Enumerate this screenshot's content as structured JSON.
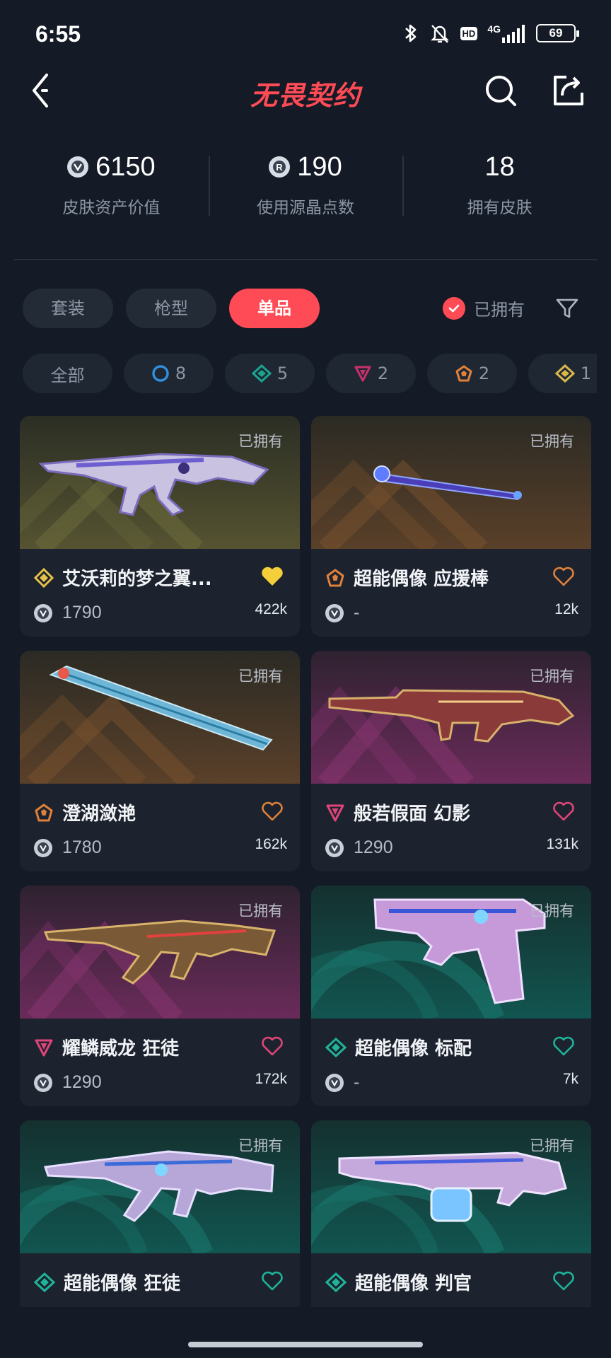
{
  "status_bar": {
    "time": "6:55",
    "network": "4G",
    "hd": "HD",
    "battery": "69"
  },
  "header": {
    "title": "无畏契约"
  },
  "stats": [
    {
      "value": "6150",
      "label": "皮肤资产价值",
      "icon": "vp-coin-icon"
    },
    {
      "value": "190",
      "label": "使用源晶点数",
      "icon": "radianite-coin-icon"
    },
    {
      "value": "18",
      "label": "拥有皮肤"
    }
  ],
  "tabs": [
    {
      "label": "套装",
      "active": false
    },
    {
      "label": "枪型",
      "active": false
    },
    {
      "label": "单品",
      "active": true
    }
  ],
  "owned_filter": {
    "label": "已拥有",
    "checked": true
  },
  "tier_chips": [
    {
      "label": "全部"
    },
    {
      "count": "8",
      "tier": "select",
      "color": "#2f8fe0"
    },
    {
      "count": "5",
      "tier": "deluxe",
      "color": "#1aa48f"
    },
    {
      "count": "2",
      "tier": "premium",
      "color": "#c8306a"
    },
    {
      "count": "2",
      "tier": "exclusive",
      "color": "#e0813a"
    },
    {
      "count": "1",
      "tier": "ultra",
      "color": "#d8b84a"
    }
  ],
  "cards": [
    {
      "owned": "已拥有",
      "title": "艾沃莉的梦之翼...",
      "price": "1790",
      "likes": "422k",
      "tier_color": "#e6c24a",
      "heart": "filled-heart-icon",
      "heart_color": "#f5cf3a"
    },
    {
      "owned": "已拥有",
      "title": "超能偶像 应援棒",
      "price": "-",
      "likes": "12k",
      "tier_color": "#e0813a",
      "heart": "outline-heart-icon",
      "heart_color": "#e0813a"
    },
    {
      "owned": "已拥有",
      "title": "澄湖潋滟",
      "price": "1780",
      "likes": "162k",
      "tier_color": "#e0813a",
      "heart": "outline-heart-icon",
      "heart_color": "#e0813a"
    },
    {
      "owned": "已拥有",
      "title": "般若假面 幻影",
      "price": "1290",
      "likes": "131k",
      "tier_color": "#e0457a",
      "heart": "outline-heart-icon",
      "heart_color": "#e0457a"
    },
    {
      "owned": "已拥有",
      "title": "耀鳞威龙 狂徒",
      "price": "1290",
      "likes": "172k",
      "tier_color": "#e0457a",
      "heart": "outline-heart-icon",
      "heart_color": "#e0457a"
    },
    {
      "owned": "已拥有",
      "title": "超能偶像 标配",
      "price": "-",
      "likes": "7k",
      "tier_color": "#1fb39a",
      "heart": "outline-heart-icon",
      "heart_color": "#1fb39a"
    },
    {
      "owned": "已拥有",
      "title": "超能偶像 狂徒",
      "price": "",
      "likes": "",
      "tier_color": "#1fb39a",
      "heart": "outline-heart-icon",
      "heart_color": "#1fb39a"
    },
    {
      "owned": "已拥有",
      "title": "超能偶像 判官",
      "price": "",
      "likes": "",
      "tier_color": "#1fb39a",
      "heart": "outline-heart-icon",
      "heart_color": "#1fb39a"
    }
  ]
}
